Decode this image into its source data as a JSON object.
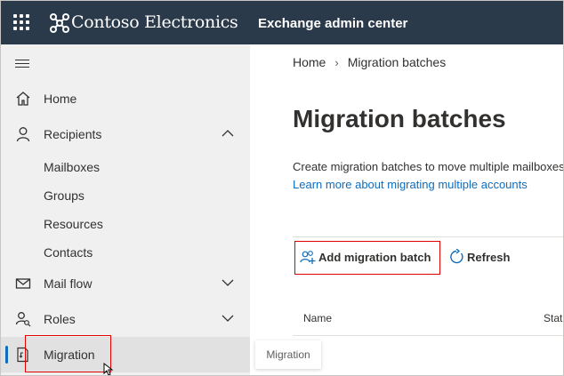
{
  "header": {
    "brand": "Contoso Electronics",
    "app_title": "Exchange admin center",
    "bg_color": "#2b3a4a"
  },
  "sidebar": {
    "items": [
      {
        "label": "Home",
        "icon": "home-icon"
      },
      {
        "label": "Recipients",
        "icon": "person-icon",
        "expanded": true,
        "children": [
          "Mailboxes",
          "Groups",
          "Resources",
          "Contacts"
        ]
      },
      {
        "label": "Mail flow",
        "icon": "mail-icon",
        "expanded": false
      },
      {
        "label": "Roles",
        "icon": "roles-icon",
        "expanded": false
      },
      {
        "label": "Migration",
        "icon": "migration-icon",
        "selected": true
      }
    ]
  },
  "tooltip": "Migration",
  "main": {
    "breadcrumb": [
      "Home",
      "Migration batches"
    ],
    "title": "Migration batches",
    "description": "Create migration batches to move multiple mailboxes",
    "learn_more_link": "Learn more about migrating multiple accounts",
    "toolbar": {
      "add_label": "Add migration batch",
      "refresh_label": "Refresh"
    },
    "table": {
      "columns": [
        "Name",
        "Status"
      ]
    }
  },
  "colors": {
    "accent": "#0f6cbd",
    "highlight_box": "#e00000"
  }
}
